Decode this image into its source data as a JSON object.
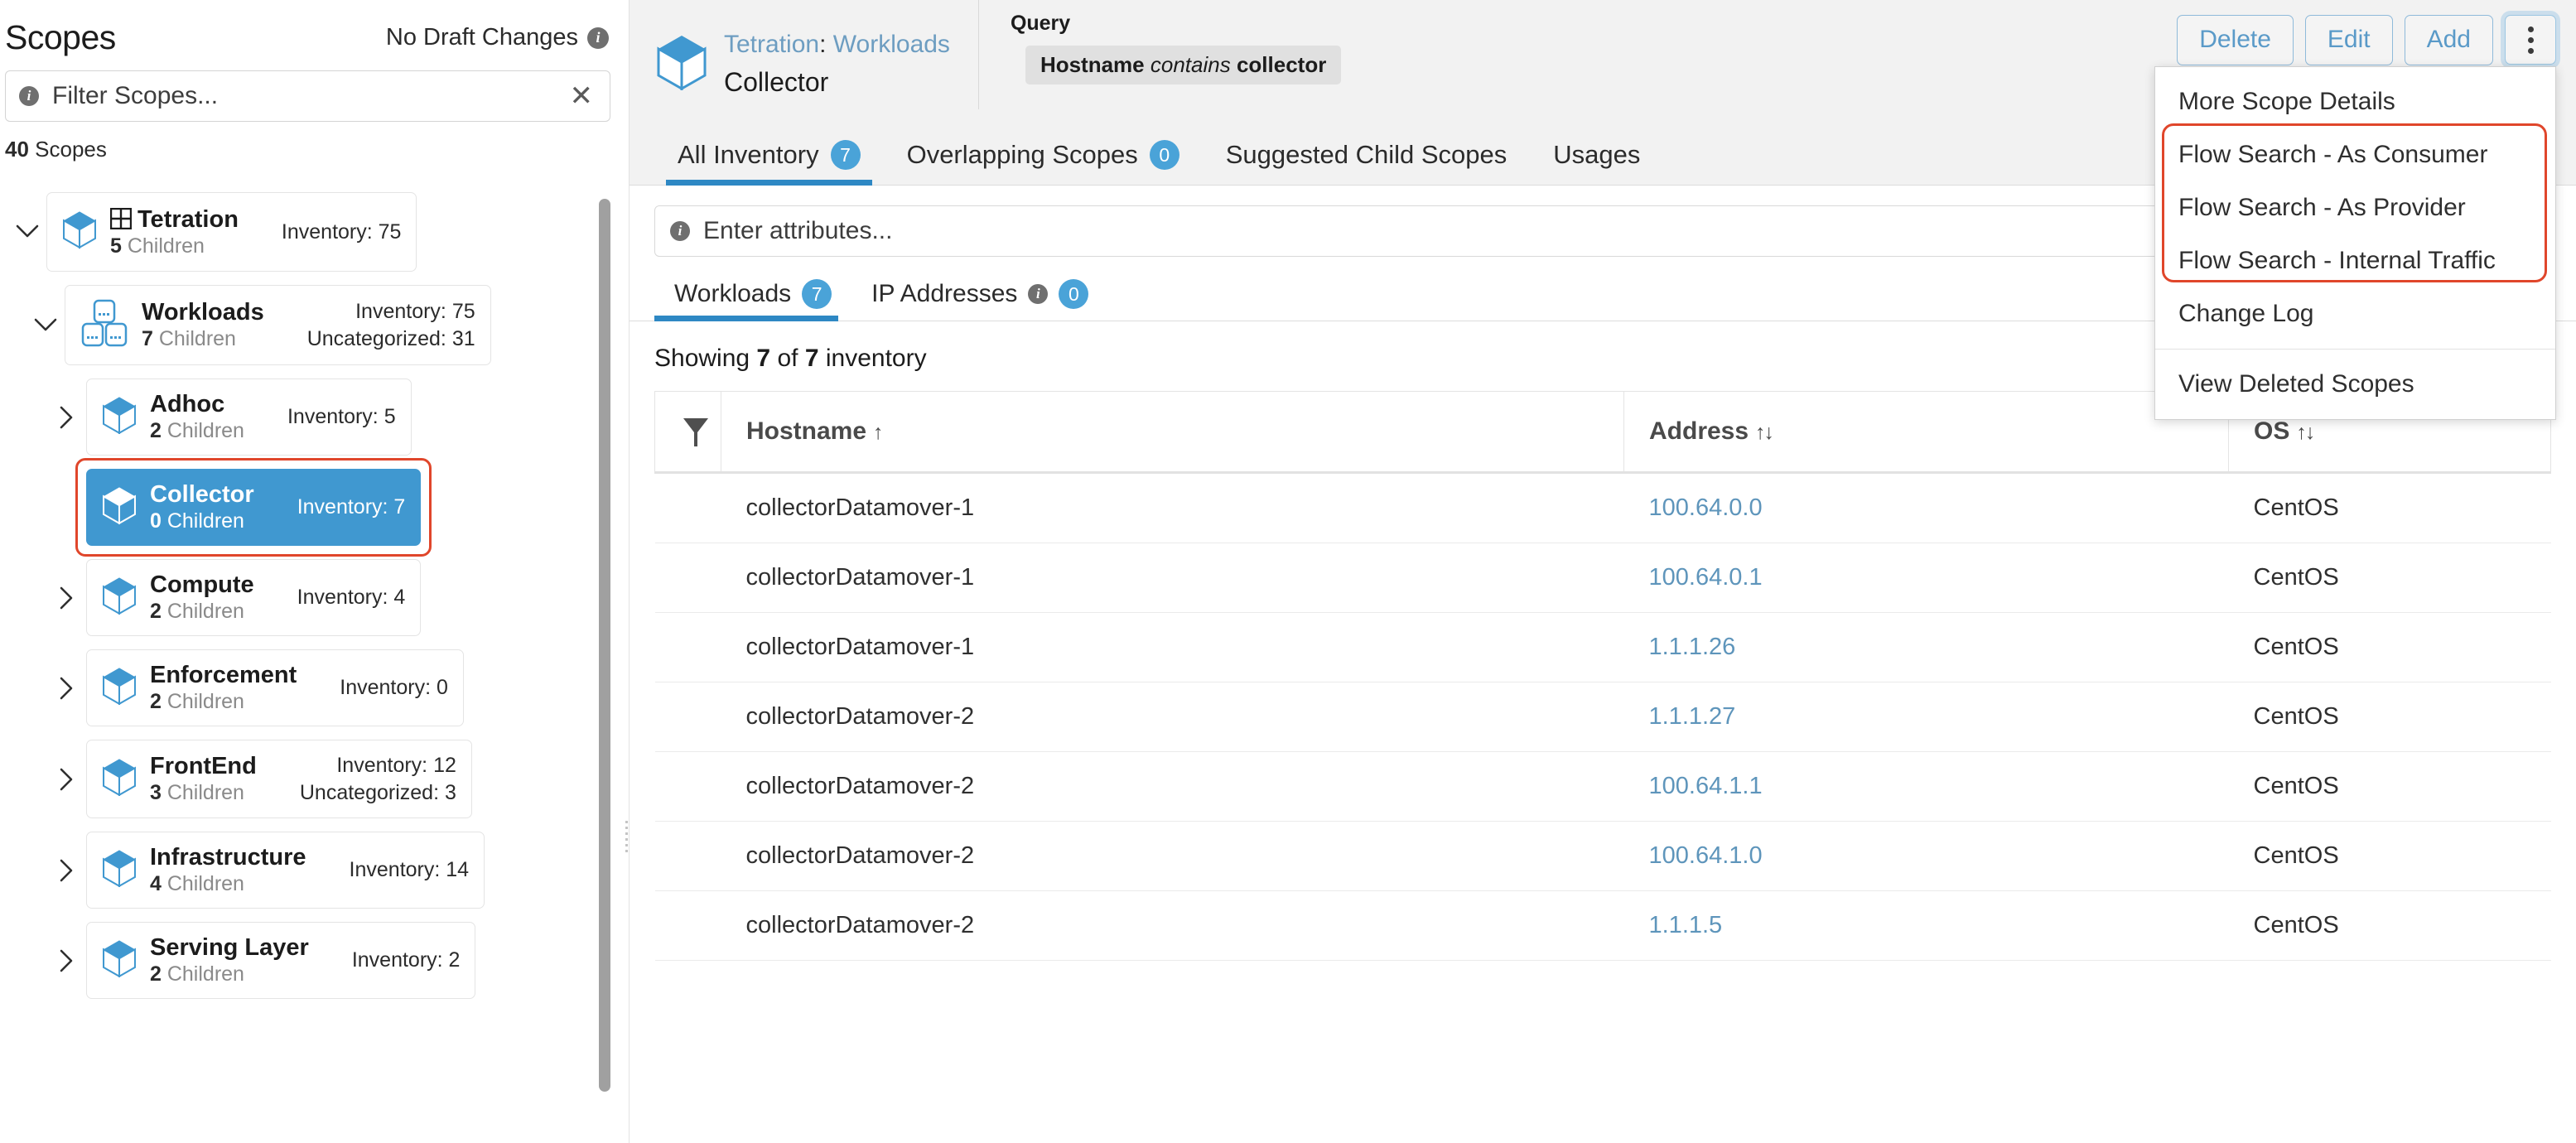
{
  "sidebar": {
    "title": "Scopes",
    "draft_status": "No Draft Changes",
    "filter_placeholder": "Filter Scopes...",
    "scope_count_number": "40",
    "scope_count_label": "Scopes",
    "items": [
      {
        "name": "Tetration",
        "children": "5",
        "children_label": "Children",
        "inventory": "Inventory: 75",
        "uncategorized": "",
        "chevron": "down",
        "icon": "cube-icon",
        "has_grid_glyph": true,
        "selected": false,
        "indent": 0
      },
      {
        "name": "Workloads",
        "children": "7",
        "children_label": "Children",
        "inventory": "Inventory: 75",
        "uncategorized": "Uncategorized: 31",
        "chevron": "down",
        "icon": "workloads-icon",
        "has_grid_glyph": false,
        "selected": false,
        "indent": 1
      },
      {
        "name": "Adhoc",
        "children": "2",
        "children_label": "Children",
        "inventory": "Inventory: 5",
        "uncategorized": "",
        "chevron": "right",
        "icon": "cube-icon",
        "has_grid_glyph": false,
        "selected": false,
        "indent": 2
      },
      {
        "name": "Collector",
        "children": "0",
        "children_label": "Children",
        "inventory": "Inventory: 7",
        "uncategorized": "",
        "chevron": "none",
        "icon": "cube-icon",
        "has_grid_glyph": false,
        "selected": true,
        "indent": 2
      },
      {
        "name": "Compute",
        "children": "2",
        "children_label": "Children",
        "inventory": "Inventory: 4",
        "uncategorized": "",
        "chevron": "right",
        "icon": "cube-icon",
        "has_grid_glyph": false,
        "selected": false,
        "indent": 2
      },
      {
        "name": "Enforcement",
        "children": "2",
        "children_label": "Children",
        "inventory": "Inventory: 0",
        "uncategorized": "",
        "chevron": "right",
        "icon": "cube-icon",
        "has_grid_glyph": false,
        "selected": false,
        "indent": 2
      },
      {
        "name": "FrontEnd",
        "children": "3",
        "children_label": "Children",
        "inventory": "Inventory: 12",
        "uncategorized": "Uncategorized: 3",
        "chevron": "right",
        "icon": "cube-icon",
        "has_grid_glyph": false,
        "selected": false,
        "indent": 2
      },
      {
        "name": "Infrastructure",
        "children": "4",
        "children_label": "Children",
        "inventory": "Inventory: 14",
        "uncategorized": "",
        "chevron": "right",
        "icon": "cube-icon",
        "has_grid_glyph": false,
        "selected": false,
        "indent": 2
      },
      {
        "name": "Serving Layer",
        "children": "2",
        "children_label": "Children",
        "inventory": "Inventory: 2",
        "uncategorized": "",
        "chevron": "right",
        "icon": "cube-icon",
        "has_grid_glyph": false,
        "selected": false,
        "indent": 2
      }
    ]
  },
  "header": {
    "breadcrumb_root": "Tetration",
    "breadcrumb_sep": ":",
    "breadcrumb_parent": "Workloads",
    "current_scope": "Collector",
    "query_label": "Query",
    "query_field": "Hostname",
    "query_operator": "contains",
    "query_value": "collector"
  },
  "actions": {
    "delete_label": "Delete",
    "edit_label": "Edit",
    "add_label": "Add",
    "kebab_icon": "kebab-menu-icon"
  },
  "dropdown": {
    "items_top": [
      "More Scope Details"
    ],
    "items_highlighted": [
      "Flow Search - As Consumer",
      "Flow Search - As Provider",
      "Flow Search - Internal Traffic"
    ],
    "items_mid": [
      "Change Log"
    ],
    "items_bottom": [
      "View Deleted Scopes"
    ],
    "highlight_color": "#e0462b"
  },
  "tabs": [
    {
      "label": "All Inventory",
      "badge": "7",
      "active": true
    },
    {
      "label": "Overlapping Scopes",
      "badge": "0",
      "active": false
    },
    {
      "label": "Suggested Child Scopes",
      "badge": "",
      "active": false
    },
    {
      "label": "Usages",
      "badge": "",
      "active": false
    }
  ],
  "attributes_input": {
    "placeholder": "Enter attributes...",
    "info_icon": "info-icon"
  },
  "subtabs": [
    {
      "label": "Workloads",
      "badge": "7",
      "info": false,
      "active": true
    },
    {
      "label": "IP Addresses",
      "badge": "0",
      "info": true,
      "active": false
    }
  ],
  "showing": {
    "prefix": "Showing",
    "shown": "7",
    "of": "of",
    "total": "7",
    "suffix": "inventory"
  },
  "table": {
    "filter_icon": "funnel-filter-icon",
    "columns": [
      {
        "label": "Hostname",
        "sort": "↑"
      },
      {
        "label": "Address",
        "sort": "↑↓"
      },
      {
        "label": "OS",
        "sort": "↑↓"
      }
    ],
    "rows": [
      {
        "hostname": "collectorDatamover-1",
        "address": "100.64.0.0",
        "os": "CentOS"
      },
      {
        "hostname": "collectorDatamover-1",
        "address": "100.64.0.1",
        "os": "CentOS"
      },
      {
        "hostname": "collectorDatamover-1",
        "address": "1.1.1.26",
        "os": "CentOS"
      },
      {
        "hostname": "collectorDatamover-2",
        "address": "1.1.1.27",
        "os": "CentOS"
      },
      {
        "hostname": "collectorDatamover-2",
        "address": "100.64.1.1",
        "os": "CentOS"
      },
      {
        "hostname": "collectorDatamover-2",
        "address": "100.64.1.0",
        "os": "CentOS"
      },
      {
        "hostname": "collectorDatamover-2",
        "address": "1.1.1.5",
        "os": "CentOS"
      }
    ]
  },
  "colors": {
    "accent_blue": "#2e88c4",
    "cube_blue": "#4098d0",
    "link_blue": "#5e95bb",
    "highlight_red": "#e0462b",
    "badge_blue": "#4aa3d8"
  }
}
